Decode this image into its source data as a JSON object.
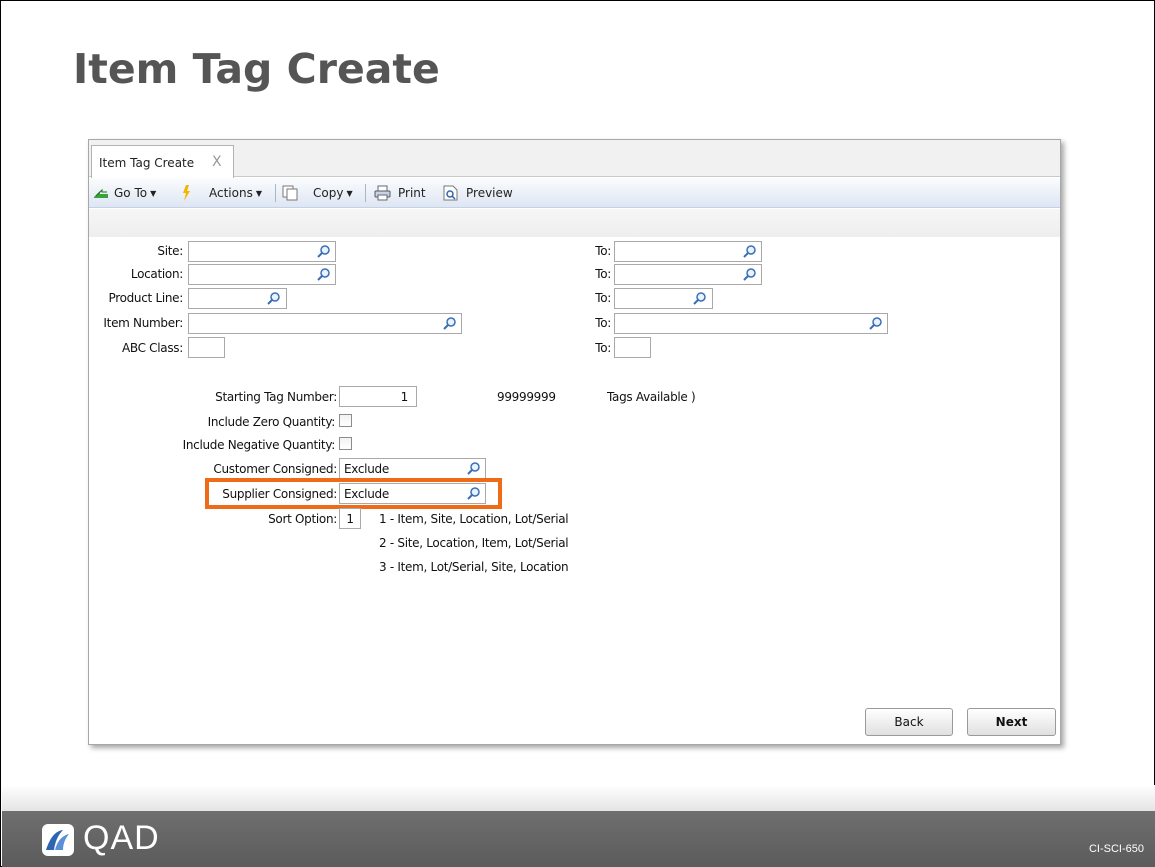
{
  "slide": {
    "title": "Item Tag Create",
    "code": "CI-SCI-650",
    "logo_text": "QAD"
  },
  "window": {
    "tab_label": "Item Tag Create",
    "tab_close": "X"
  },
  "toolbar": {
    "goto": "Go To",
    "actions": "Actions",
    "copy": "Copy",
    "print": "Print",
    "preview": "Preview"
  },
  "form": {
    "site_label": "Site:",
    "location_label": "Location:",
    "product_line_label": "Product Line:",
    "item_number_label": "Item Number:",
    "abc_class_label": "ABC Class:",
    "to_label": "To:",
    "starting_tag_label": "Starting Tag Number:",
    "starting_tag_value": "1",
    "max_tag_value": "99999999",
    "tags_available": "Tags Available )",
    "include_zero_label": "Include Zero Quantity:",
    "include_negative_label": "Include Negative Quantity:",
    "customer_consigned_label": "Customer Consigned:",
    "customer_consigned_value": "Exclude",
    "supplier_consigned_label": "Supplier Consigned:",
    "supplier_consigned_value": "Exclude",
    "sort_option_label": "Sort Option:",
    "sort_option_value": "1",
    "sort_options": [
      "1 - Item, Site, Location, Lot/Serial",
      "2 - Site, Location, Item, Lot/Serial",
      "3 - Item, Lot/Serial, Site, Location"
    ]
  },
  "buttons": {
    "back": "Back",
    "next": "Next"
  },
  "colors": {
    "highlight": "#ee6c17",
    "title_gray": "#555555",
    "footer_gray": "#636363"
  }
}
